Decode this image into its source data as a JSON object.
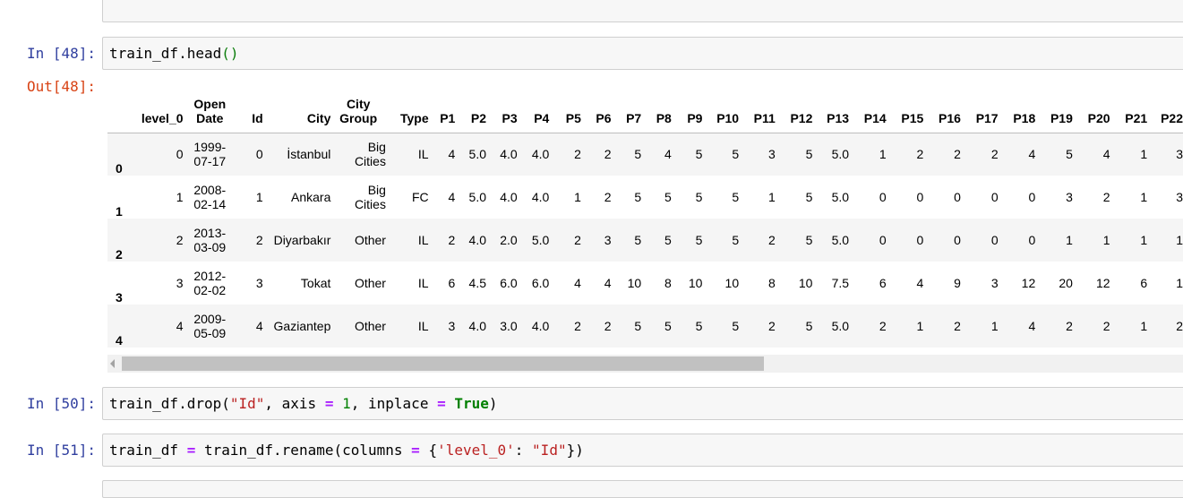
{
  "cells": {
    "c48": {
      "prompt": "In [48]:",
      "code": [
        "train_df.head",
        "()"
      ]
    },
    "out48": {
      "prompt": "Out[48]:"
    },
    "c50": {
      "prompt": "In [50]:",
      "code": [
        "train_df.drop(",
        "\"Id\"",
        ", axis ",
        "=",
        " ",
        "1",
        ", inplace ",
        "=",
        " ",
        "True",
        ")"
      ]
    },
    "c51": {
      "prompt": "In [51]:",
      "code": [
        "train_df ",
        "=",
        " train_df.rename(columns ",
        "=",
        " {",
        "'level_0'",
        ": ",
        "\"Id\"",
        "})"
      ]
    }
  },
  "table": {
    "columns": [
      "",
      "level_0",
      "Open Date",
      "Id",
      "City",
      "City Group",
      "Type",
      "P1",
      "P2",
      "P3",
      "P4",
      "P5",
      "P6",
      "P7",
      "P8",
      "P9",
      "P10",
      "P11",
      "P12",
      "P13",
      "P14",
      "P15",
      "P16",
      "P17",
      "P18",
      "P19",
      "P20",
      "P21",
      "P22"
    ],
    "rows": [
      [
        "0",
        "0",
        "1999-07-17",
        "0",
        "İstanbul",
        "Big Cities",
        "IL",
        "4",
        "5.0",
        "4.0",
        "4.0",
        "2",
        "2",
        "5",
        "4",
        "5",
        "5",
        "3",
        "5",
        "5.0",
        "1",
        "2",
        "2",
        "2",
        "4",
        "5",
        "4",
        "1",
        "3"
      ],
      [
        "1",
        "1",
        "2008-02-14",
        "1",
        "Ankara",
        "Big Cities",
        "FC",
        "4",
        "5.0",
        "4.0",
        "4.0",
        "1",
        "2",
        "5",
        "5",
        "5",
        "5",
        "1",
        "5",
        "5.0",
        "0",
        "0",
        "0",
        "0",
        "0",
        "3",
        "2",
        "1",
        "3"
      ],
      [
        "2",
        "2",
        "2013-03-09",
        "2",
        "Diyarbakır",
        "Other",
        "IL",
        "2",
        "4.0",
        "2.0",
        "5.0",
        "2",
        "3",
        "5",
        "5",
        "5",
        "5",
        "2",
        "5",
        "5.0",
        "0",
        "0",
        "0",
        "0",
        "0",
        "1",
        "1",
        "1",
        "1"
      ],
      [
        "3",
        "3",
        "2012-02-02",
        "3",
        "Tokat",
        "Other",
        "IL",
        "6",
        "4.5",
        "6.0",
        "6.0",
        "4",
        "4",
        "10",
        "8",
        "10",
        "10",
        "8",
        "10",
        "7.5",
        "6",
        "4",
        "9",
        "3",
        "12",
        "20",
        "12",
        "6",
        "1"
      ],
      [
        "4",
        "4",
        "2009-05-09",
        "4",
        "Gaziantep",
        "Other",
        "IL",
        "3",
        "4.0",
        "3.0",
        "4.0",
        "2",
        "2",
        "5",
        "5",
        "5",
        "5",
        "2",
        "5",
        "5.0",
        "2",
        "1",
        "2",
        "1",
        "4",
        "2",
        "2",
        "1",
        "2"
      ]
    ]
  },
  "colors": {
    "prompt_in": "#303f9f",
    "prompt_out": "#d84315",
    "cell_bg": "#f7f7f7",
    "string": "#ba2121",
    "operator": "#aa22ff",
    "keyword": "#008000"
  }
}
